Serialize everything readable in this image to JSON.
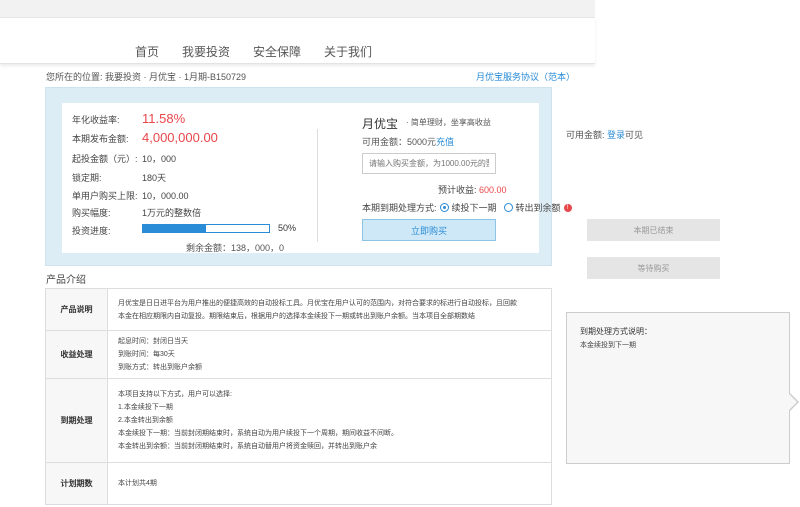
{
  "nav": {
    "items": [
      "首页",
      "我要投资",
      "安全保障",
      "关于我们"
    ]
  },
  "breadcrumb": "您所在的位置:  我要投资 · 月优宝 · 1月期-B150729",
  "agreement_link": "月优宝服务协议（范本）",
  "details": {
    "rate_label": "年化收益率:",
    "rate_value": "11.58%",
    "amount_label": "本期发布金额:",
    "amount_value": "4,000,000.00",
    "min_label": "起投金额（元）:",
    "min_value": "10，000",
    "lock_label": "锁定期:",
    "lock_value": "180天",
    "limit_label": "单用户购买上限:",
    "limit_value": "10，000.00",
    "step_label": "购买幅度:",
    "step_value": "1万元的整数倍",
    "progress_label": "投资进度:",
    "progress_value": 0.5,
    "progress_text": "50%",
    "remaining_text": "剩余金额：138，000，0"
  },
  "purchase": {
    "title": "月优宝",
    "slogan": "· 简单理财，坐享高收益",
    "available_label": "可用金额：5000元",
    "recharge_link": "充值",
    "input_placeholder": "请输入购买金额，为1000.00元的整倍",
    "expected_label": "预计收益:",
    "expected_value": "600.00",
    "handling_label": "本期到期处理方式:",
    "option1": "续投下一期",
    "option2": "转出到余额",
    "buy_button": "立即购买"
  },
  "sidebar": {
    "available_label": "可用金额:",
    "login_link": "登录",
    "available_suffix": "可见",
    "ended_button": "本期已结束",
    "waiting_button": "等待购买"
  },
  "intro": {
    "title": "产品介绍",
    "rows": [
      {
        "head": "产品说明",
        "lines": [
          "月优宝是日日进平台为用户推出的便捷高效的自动投标工具。月优宝在用户认可的范围内，对符合要求的标进行自动投标，且回款",
          "本金在相应期限内自动复投。期限结束后，根据用户的选择本金续投下一期或转出到账户余额。当本项目全部期数结"
        ]
      },
      {
        "head": "收益处理",
        "lines": [
          "起息时间：封闭日当天",
          "到账时间：每30天",
          "到账方式：转出到账户余额"
        ]
      },
      {
        "head": "到期处理",
        "lines": [
          "本项目支持以下方式，用户可以选择:",
          "1.本金续投下一期",
          "2.本金转出到余额",
          "本金续投下一期：当前封闭期结束时，系统自动为用户续投下一个周期，期间收益不间断。",
          "本金转出到余额：当前封闭期结束时，系统自动替用户将资金赎回，并转出到账户余"
        ]
      },
      {
        "head": "计划期数",
        "lines": [
          "本计划共4期"
        ]
      }
    ]
  },
  "tip": {
    "title": "到期处理方式说明：",
    "text": "本金续投到下一期"
  },
  "colors": {
    "accent": "#2a8cd6",
    "red": "#e8474b",
    "panel_bg": "#dcedf6"
  }
}
